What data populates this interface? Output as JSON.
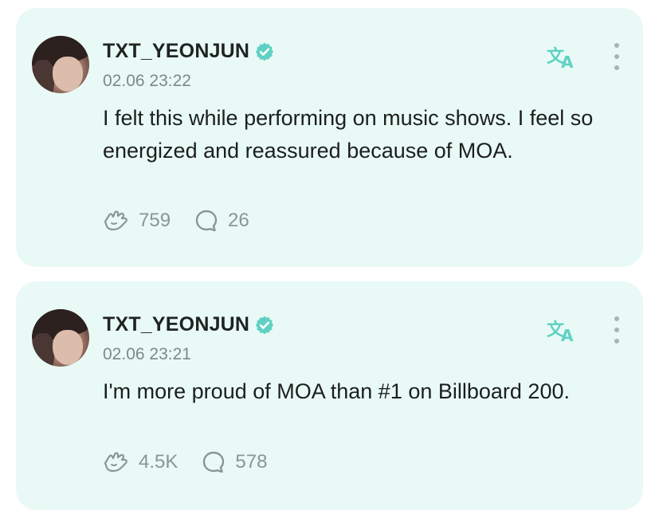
{
  "colors": {
    "card_background": "#e9faf6",
    "accent": "#5fd1c4",
    "verified_badge": "#5fd1c4",
    "muted_text": "#8a9693"
  },
  "posts": [
    {
      "username": "TXT_YEONJUN",
      "verified_icon": "verified-badge-icon",
      "timestamp": "02.06 23:22",
      "text": "I felt this while performing on music shows. I feel so energized and reassured because of MOA.",
      "likes": "759",
      "comments": "26",
      "translate_icon": "translate-icon",
      "more_icon": "more-vertical-icon"
    },
    {
      "username": "TXT_YEONJUN",
      "verified_icon": "verified-badge-icon",
      "timestamp": "02.06 23:21",
      "text": "I'm more proud of MOA than #1 on Billboard 200.",
      "likes": "4.5K",
      "comments": "578",
      "translate_icon": "translate-icon",
      "more_icon": "more-vertical-icon"
    }
  ]
}
